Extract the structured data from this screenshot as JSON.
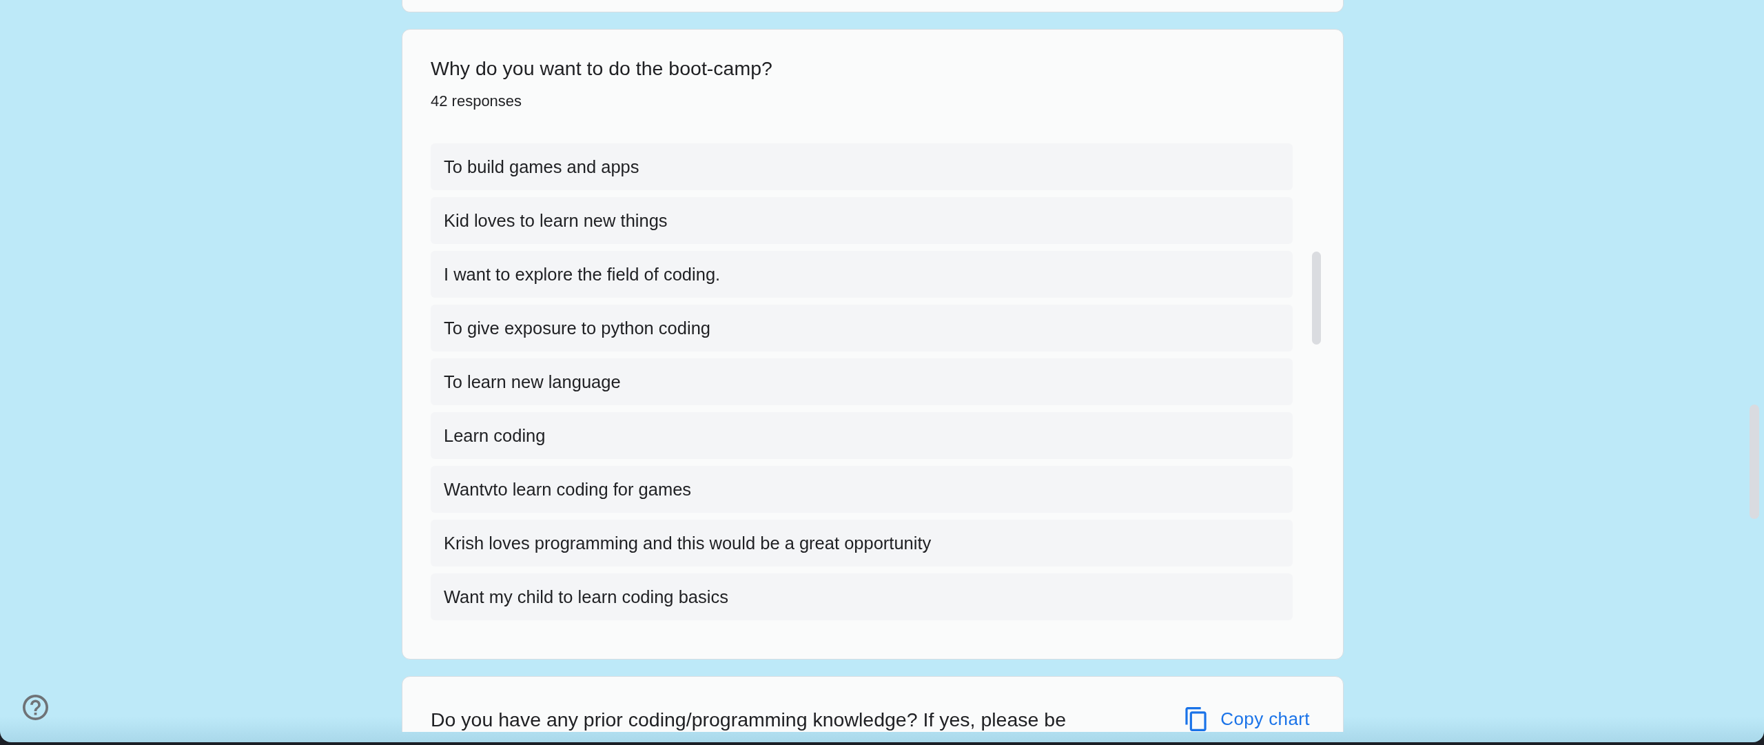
{
  "cards": [
    {
      "kind": "text_responses",
      "title": "Why do you want to do the boot-camp?",
      "response_count": "42 responses",
      "responses": [
        "To build games and apps",
        "Kid loves to learn new things",
        "I want to explore the field of coding.",
        "To give exposure to python coding",
        "To learn new language",
        "Learn coding",
        "Wantvto learn coding for games",
        "Krish loves programming and this would be a great opportunity",
        "Want my child to learn coding basics"
      ]
    },
    {
      "kind": "chart",
      "title": "Do you have any prior coding/programming knowledge? If yes, please be",
      "copy_button": "Copy chart"
    }
  ]
}
